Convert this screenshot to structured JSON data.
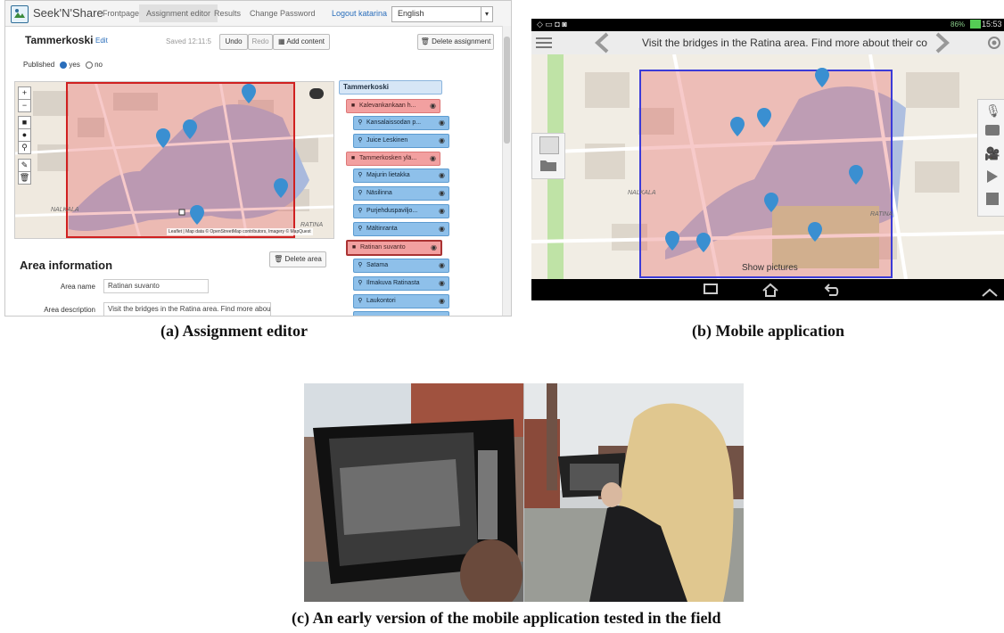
{
  "captions": {
    "a": "(a) Assignment editor",
    "b": "(b) Mobile application",
    "c": "(c) An early version of the mobile application tested in the field"
  },
  "editor": {
    "brand": "Seek'N'Share",
    "nav": [
      "Frontpage",
      "Assignment editor",
      "Results",
      "Change Password"
    ],
    "logout": "Logout katarina",
    "language": "English",
    "assignment_title": "Tammerkoski",
    "edit_link": "Edit",
    "saved": "Saved 12:11:5",
    "undo": "Undo",
    "redo": "Redo",
    "add_content": "Add content",
    "delete_assignment": "Delete assignment",
    "published_label": "Published",
    "published_yes": "yes",
    "published_no": "no",
    "map_attribution": "Leaflet | Map data © OpenStreetMap contributors, Imagery © MapQuest",
    "map_labels": [
      "NALKALA",
      "RATINA"
    ],
    "area_info_title": "Area information",
    "delete_area": "Delete area",
    "area_name_label": "Area name",
    "area_name_value": "Ratinan suvanto",
    "area_desc_label": "Area description",
    "area_desc_value": "Visit the bridges in the Ratina area. Find more about"
  },
  "tree": {
    "root": "Tammerkoski",
    "areas": [
      {
        "label": "Kalevankankaan h...",
        "points": [
          "Kansalaissodan p...",
          "Juice Leskinen"
        ]
      },
      {
        "label": "Tammerkosken ylä...",
        "points": [
          "Majurin lietakka",
          "Näsilinna",
          "Purjehduspaviljo...",
          "Mältinranta"
        ]
      },
      {
        "label": "Ratinan suvanto",
        "points": [
          "Satama",
          "Ilmakuva Ratinasta",
          "Laukontori"
        ]
      }
    ]
  },
  "mobile": {
    "status_time": "15:53",
    "status_battery": "86%",
    "title": "Visit the bridges in the Ratina area. Find more about their co",
    "show_pictures": "Show pictures",
    "map_labels": [
      "NALKALA",
      "RATINA"
    ]
  }
}
